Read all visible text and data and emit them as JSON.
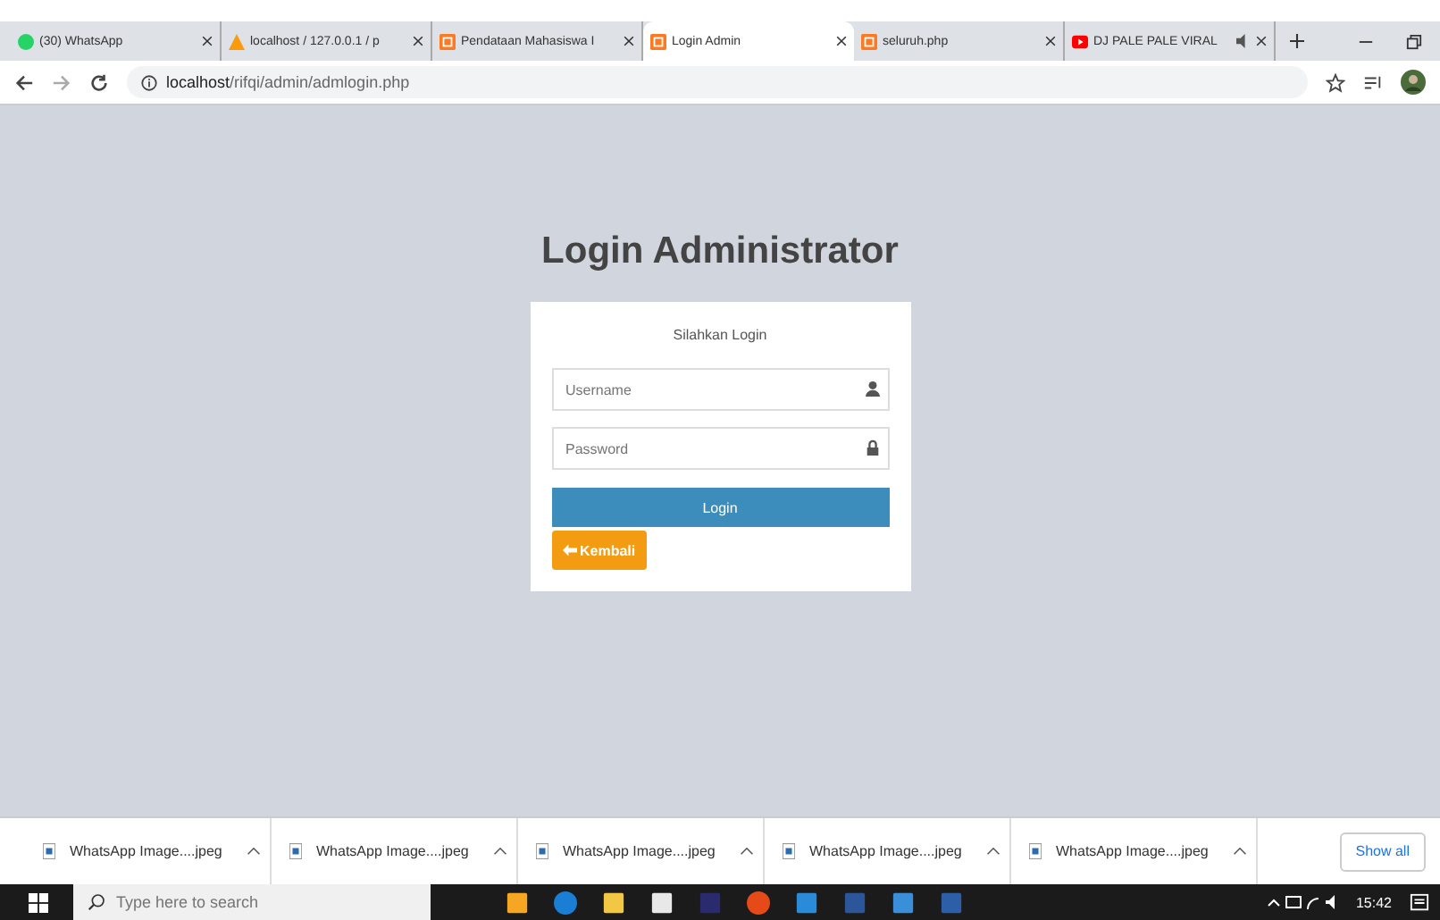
{
  "tabs": [
    {
      "label": "(30) WhatsApp",
      "kind": "chat",
      "selected": false
    },
    {
      "label": "localhost / 127.0.0.1 / p",
      "kind": "sail",
      "selected": false
    },
    {
      "label": "Pendataan Mahasiswa I",
      "kind": "server",
      "selected": false
    },
    {
      "label": "Login Admin",
      "kind": "server",
      "selected": true
    },
    {
      "label": "seluruh.php",
      "kind": "server",
      "selected": false
    },
    {
      "label": "DJ PALE PALE VIRAL",
      "kind": "video",
      "selected": false,
      "audio": true
    }
  ],
  "address_bar": {
    "host": "localhost",
    "path": "/rifqi/admin/admlogin.php"
  },
  "login": {
    "title": "Login Administrator",
    "subtitle": "Silahkan Login",
    "username_placeholder": "Username",
    "password_placeholder": "Password",
    "submit": "Login",
    "back": "Kembali"
  },
  "downloads": [
    {
      "name": "WhatsApp Image....jpeg"
    },
    {
      "name": "WhatsApp Image....jpeg"
    },
    {
      "name": "WhatsApp Image....jpeg"
    },
    {
      "name": "WhatsApp Image....jpeg"
    },
    {
      "name": "WhatsApp Image....jpeg"
    }
  ],
  "show_all": "Show all",
  "taskbar": {
    "search_placeholder": "Type here to search",
    "time": "15:42"
  }
}
